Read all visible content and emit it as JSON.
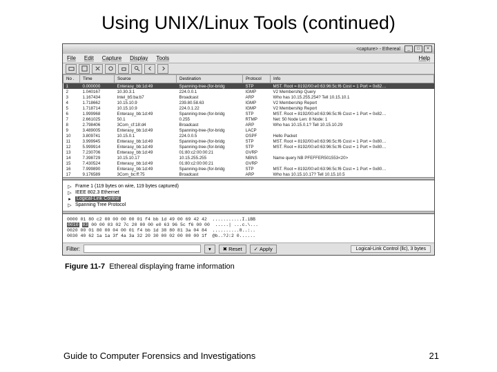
{
  "title": "Using UNIX/Linux Tools (continued)",
  "window_title": "<capture> - Ethereal",
  "menu": {
    "file": "File",
    "edit": "Edit",
    "capture": "Capture",
    "display": "Display",
    "tools": "Tools",
    "help": "Help"
  },
  "headers": {
    "no": "No .",
    "time": "Time",
    "src": "Source",
    "dst": "Destination",
    "proto": "Protocol",
    "info": "Info"
  },
  "rows": [
    {
      "no": "1",
      "time": "0.000000",
      "src": "Enterasy_bb:1d:49",
      "dst": "Spanning-tree-(for-bridg",
      "proto": "STP",
      "info": "MST. Root = 8192/00:e0:63:96:5c:f6  Cost = 1  Port = 0x82…"
    },
    {
      "no": "2",
      "time": "1.040167",
      "src": "10.30.3.1",
      "dst": "224.0.0.1",
      "proto": "IGMP",
      "info": "V2 Membership Query"
    },
    {
      "no": "3",
      "time": "1.167434",
      "src": "Intel_b5:ba:b7",
      "dst": "Broadcast",
      "proto": "ARP",
      "info": "Who has 10.15.255.254? Tell 10.15.10.1"
    },
    {
      "no": "4",
      "time": "1.718662",
      "src": "10.15.10.9",
      "dst": "239.80.58.63",
      "proto": "IGMP",
      "info": "V2 Membership Report"
    },
    {
      "no": "5",
      "time": "1.718714",
      "src": "10.15.10.9",
      "dst": "224.0.1.22",
      "proto": "IGMP",
      "info": "V2 Membership Report"
    },
    {
      "no": "6",
      "time": "1.999968",
      "src": "Enterasy_bb:1d:49",
      "dst": "Spanning-tree-(for-bridg",
      "proto": "STP",
      "info": "MST. Root = 8192/00:e0:63:96:5c:f6  Cost = 1  Port = 0x82…"
    },
    {
      "no": "7",
      "time": "2.661025",
      "src": "50.1",
      "dst": "0.255",
      "proto": "RTMP",
      "info": "Net: 50  Node Len: 8  Node: 1"
    },
    {
      "no": "8",
      "time": "2.798406",
      "src": "3Com_cf:18:d4",
      "dst": "Broadcast",
      "proto": "ARP",
      "info": "Who has 10.15.0.1? Tell 10.15.10.29"
    },
    {
      "no": "9",
      "time": "3.489005",
      "src": "Enterasy_bb:1d:49",
      "dst": "Spanning-tree-(for-bridg",
      "proto": "LACP",
      "info": ""
    },
    {
      "no": "10",
      "time": "3.809741",
      "src": "10.15.0.1",
      "dst": "224.0.0.5",
      "proto": "OSPF",
      "info": "Hello Packet"
    },
    {
      "no": "11",
      "time": "3.999945",
      "src": "Enterasy_bb:1d:49",
      "dst": "Spanning-tree-(for-bridg",
      "proto": "STP",
      "info": "MST. Root = 8192/00:e0:63:96:5c:f6  Cost = 1  Port = 0x80…"
    },
    {
      "no": "12",
      "time": "5.999914",
      "src": "Enterasy_bb:1d:49",
      "dst": "Spanning-tree-(for-bridg",
      "proto": "STP",
      "info": "MST. Root = 8192/00:e0:63:96:5c:f6  Cost = 1  Port = 0x80…"
    },
    {
      "no": "13",
      "time": "7.230706",
      "src": "Enterasy_bb:1d:49",
      "dst": "01:80:c2:00:00:21",
      "proto": "GVRP",
      "info": ""
    },
    {
      "no": "14",
      "time": "7.398729",
      "src": "10.15.10.17",
      "dst": "10.15.255.255",
      "proto": "NBNS",
      "info": "Name query NB PFEFFER501553<20>"
    },
    {
      "no": "15",
      "time": "7.430524",
      "src": "Enterasy_bb:1d:49",
      "dst": "01:80:c2:00:00:21",
      "proto": "GVRP",
      "info": ""
    },
    {
      "no": "16",
      "time": "7.999890",
      "src": "Enterasy_bb:1d:49",
      "dst": "Spanning-tree-(for-bridg",
      "proto": "STP",
      "info": "MST. Root = 8192/00:e0:63:96:5c:f6  Cost = 1  Port = 0x80…"
    },
    {
      "no": "17",
      "time": "9.176589",
      "src": "3Com_bc:ff:75",
      "dst": "Broadcast",
      "proto": "ARP",
      "info": "Who has 10.15.10.17? Tell 10.15.10.5"
    }
  ],
  "tree": {
    "frame": "Frame 1 (119 bytes on wire, 119 bytes captured)",
    "ether": "IEEE 802.3 Ethernet",
    "llc": "Logical-Link Control",
    "stp": "Spanning Tree Protocol"
  },
  "hex": [
    "0000 01 80 c2 00 00 00 00 01 f4 bb 1d 49 00 69 42 42  ...........I.iBB",
    "0010 03 00 00 03 02 7c 20 00 00 e0 63 96 5c f6 00 00  .....| ...c.\\\\...",
    "0020 00 01 80 00 04 00 01 f4 bb 1d 38 80 81 3a 04 84  ..........8..:..",
    "0030 40 62 1a 1a 3f 4a 3a 32 20 30 00 02 00 00 00 1f  @b..?J:2 0......"
  ],
  "filter": {
    "label": "Filter:",
    "placeholder": "",
    "reset": "Reset",
    "apply": "Apply",
    "status": "Logical-Link Control (llc), 3 bytes"
  },
  "caption_label": "Figure 11-7",
  "caption_text": "Ethereal displaying frame information",
  "footer_left": "Guide to Computer Forensics and Investigations",
  "footer_right": "21"
}
